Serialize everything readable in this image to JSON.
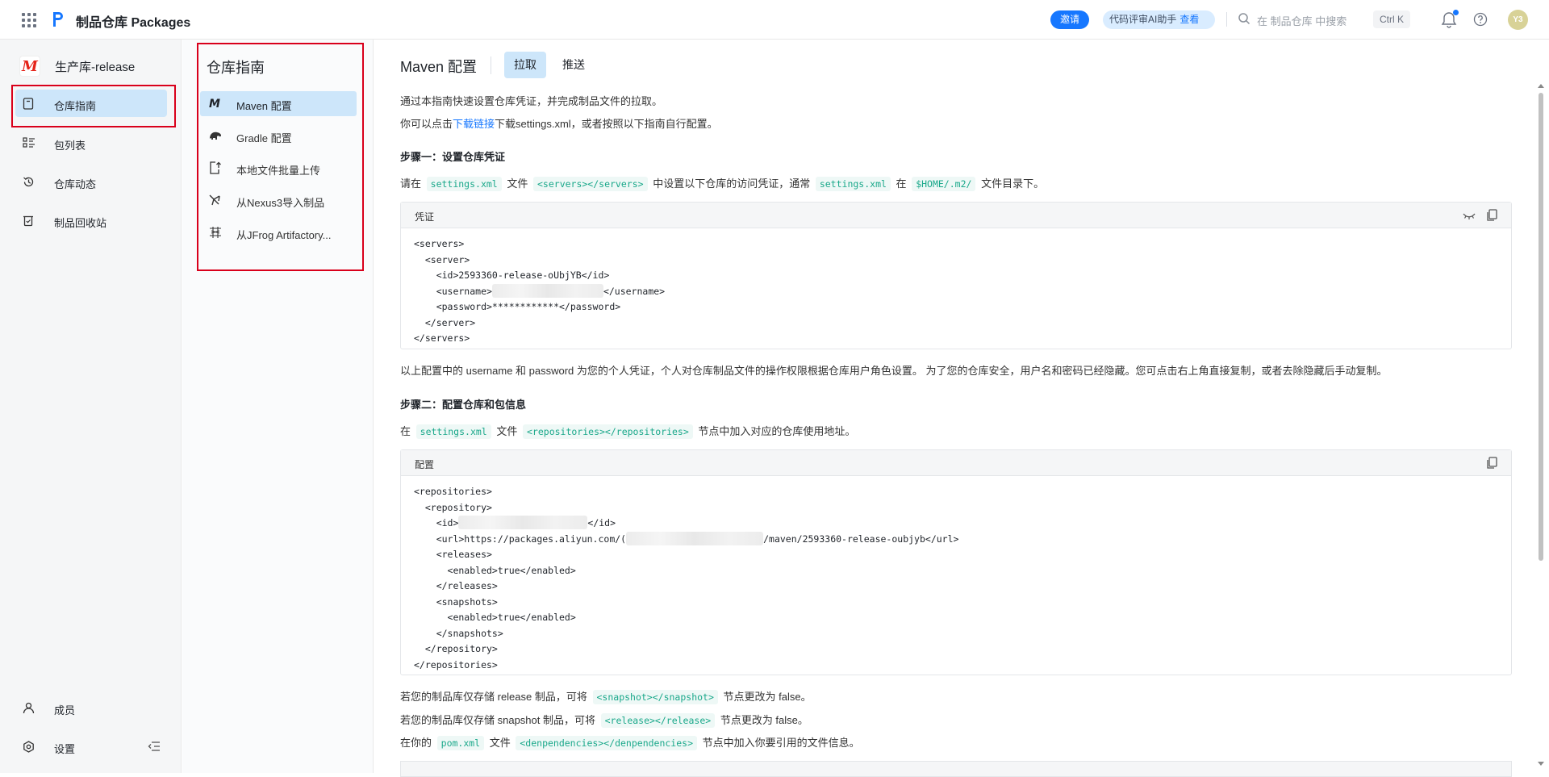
{
  "topbar": {
    "app_title": "制品仓库 Packages",
    "invite": "邀请",
    "ai_assistant": "代码评审AI助手",
    "ai_view": "查看",
    "search_placeholder": "在 制品仓库 中搜索",
    "shortcut": "Ctrl K",
    "avatar_initials": "Y3",
    "brand_color": "#1677ff"
  },
  "sidebar": {
    "repo_badge": "M",
    "repo_name": "生产库-release",
    "items": [
      {
        "label": "仓库指南",
        "icon": "book-icon",
        "active": true
      },
      {
        "label": "包列表",
        "icon": "list-icon"
      },
      {
        "label": "仓库动态",
        "icon": "history-icon"
      },
      {
        "label": "制品回收站",
        "icon": "trash-icon"
      }
    ],
    "bottom": [
      {
        "label": "成员",
        "icon": "user-icon"
      },
      {
        "label": "设置",
        "icon": "settings-icon"
      }
    ]
  },
  "guide": {
    "title": "仓库指南",
    "items": [
      {
        "label": "Maven 配置",
        "active": true
      },
      {
        "label": "Gradle 配置"
      },
      {
        "label": "本地文件批量上传"
      },
      {
        "label": "从Nexus3导入制品"
      },
      {
        "label": "从JFrog Artifactory..."
      }
    ]
  },
  "main": {
    "title": "Maven 配置",
    "tab_pull": "拉取",
    "tab_push": "推送",
    "intro1": "通过本指南快速设置仓库凭证，并完成制品文件的拉取。",
    "intro2_a": "你可以点击",
    "intro2_link": "下载链接",
    "intro2_b": "下载settings.xml，或者按照以下指南自行配置。",
    "step1": "步骤一：设置仓库凭证",
    "step1_a": "请在",
    "step1_code1": "settings.xml",
    "step1_b": "文件",
    "step1_code2": "<servers></servers>",
    "step1_c": "中设置以下仓库的访问凭证，通常",
    "step1_code3": "settings.xml",
    "step1_d": "在",
    "step1_code4": "$HOME/.m2/",
    "step1_e": "文件目录下。",
    "cred_title": "凭证",
    "cred_lines": {
      "l1": "<servers>",
      "l2": "  <server>",
      "l3": "    <id>2593360-release-oUbjYB</id>",
      "l4a": "    <username>",
      "l4b": "</username>",
      "l5": "    <password>************</password>",
      "l6": "  </server>",
      "l7": "</servers>"
    },
    "cred_note": "以上配置中的 username 和 password 为您的个人凭证，个人对仓库制品文件的操作权限根据仓库用户角色设置。 为了您的仓库安全，用户名和密码已经隐藏。您可点击右上角直接复制，或者去除隐藏后手动复制。",
    "step2": "步骤二：配置仓库和包信息",
    "step2_a": "在",
    "step2_code1": "settings.xml",
    "step2_b": "文件",
    "step2_code2": "<repositories></repositories>",
    "step2_c": "节点中加入对应的仓库使用地址。",
    "config_title": "配置",
    "config_lines": {
      "l1": "<repositories>",
      "l2": "  <repository>",
      "l3a": "    <id>",
      "l3b": "</id>",
      "l4a": "    <url>https://packages.aliyun.com/(",
      "l4b": "/maven/2593360-release-oubjyb</url>",
      "l5": "    <releases>",
      "l6": "      <enabled>true</enabled>",
      "l7": "    </releases>",
      "l8": "    <snapshots>",
      "l9": "      <enabled>true</enabled>",
      "l10": "    </snapshots>",
      "l11": "  </repository>",
      "l12": "</repositories>"
    },
    "note1_a": "若您的制品库仅存储 release 制品，可将",
    "note1_code": "<snapshot></snapshot>",
    "note1_b": "节点更改为 false。",
    "note2_a": "若您的制品库仅存储 snapshot 制品，可将",
    "note2_code": "<release></release>",
    "note2_b": "节点更改为 false。",
    "note3_a": "在你的",
    "note3_code1": "pom.xml",
    "note3_b": "文件",
    "note3_code2": "<denpendencies></denpendencies>",
    "note3_c": "节点中加入你要引用的文件信息。"
  }
}
